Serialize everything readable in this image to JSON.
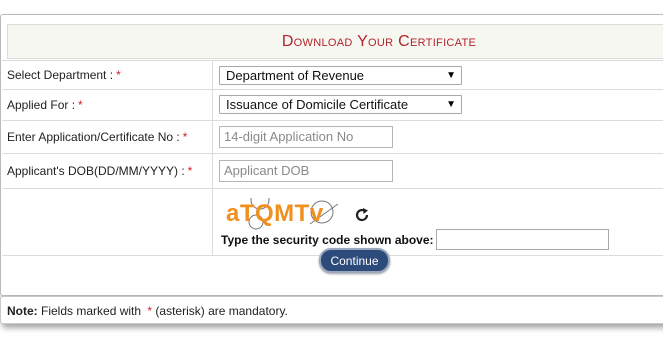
{
  "header": {
    "title": "Download Your Certificate"
  },
  "form": {
    "department": {
      "label": "Select Department :",
      "required": "*",
      "value": "Department of Revenue"
    },
    "applied_for": {
      "label": "Applied For :",
      "required": "*",
      "value": "Issuance of Domicile Certificate"
    },
    "application_no": {
      "label": "Enter Application/Certificate No :",
      "required": "*",
      "placeholder": "14-digit Application No"
    },
    "dob": {
      "label": "Applicant's DOB(DD/MM/YYYY) :",
      "required": "*",
      "placeholder": "Applicant DOB"
    },
    "captcha": {
      "text": "aTQMTv",
      "security_label": "Type the security code shown above:",
      "value": ""
    },
    "continue_label": "Continue"
  },
  "note": {
    "prefix": "Note:",
    "text_before": "Fields marked with",
    "asterisk": "*",
    "text_after": "(asterisk) are mandatory."
  },
  "colors": {
    "title": "#b3242b",
    "required": "#d0202a",
    "button": "#2c4a7a",
    "captcha": "#f0901e"
  },
  "icons": {
    "refresh": "refresh-icon",
    "dropdown": "chevron-down-icon"
  }
}
